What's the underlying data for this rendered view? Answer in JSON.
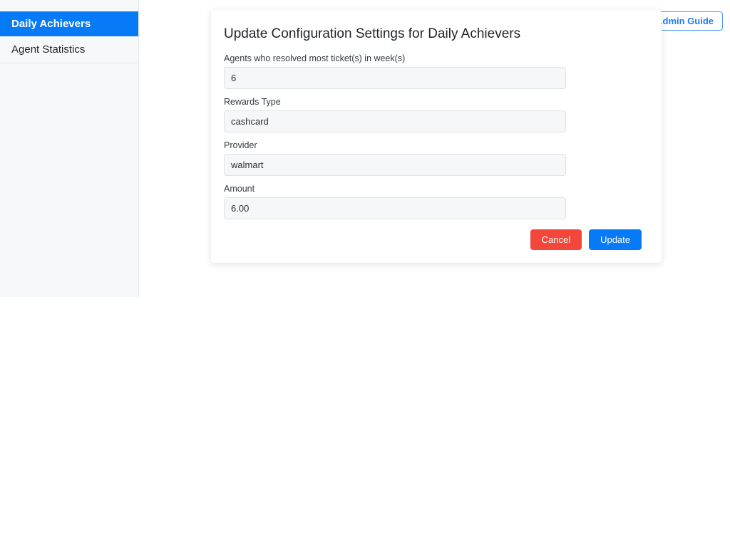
{
  "sidebar": {
    "items": [
      {
        "label": "Daily Achievers",
        "active": true
      },
      {
        "label": "Agent Statistics",
        "active": false
      }
    ]
  },
  "header": {
    "admin_guide_label": "Admin Guide"
  },
  "card": {
    "title": "Update Configuration Settings for Daily Achievers",
    "fields": [
      {
        "label": "Agents who resolved most ticket(s) in week(s)",
        "value": "6"
      },
      {
        "label": "Rewards Type",
        "value": "cashcard"
      },
      {
        "label": "Provider",
        "value": "walmart"
      },
      {
        "label": "Amount",
        "value": "6.00"
      }
    ],
    "buttons": {
      "cancel_label": "Cancel",
      "update_label": "Update"
    }
  },
  "colors": {
    "accent_blue": "#077bf7",
    "danger_red": "#f4473b",
    "sidebar_bg": "#f7f8fa",
    "input_bg": "#f6f7f8"
  }
}
